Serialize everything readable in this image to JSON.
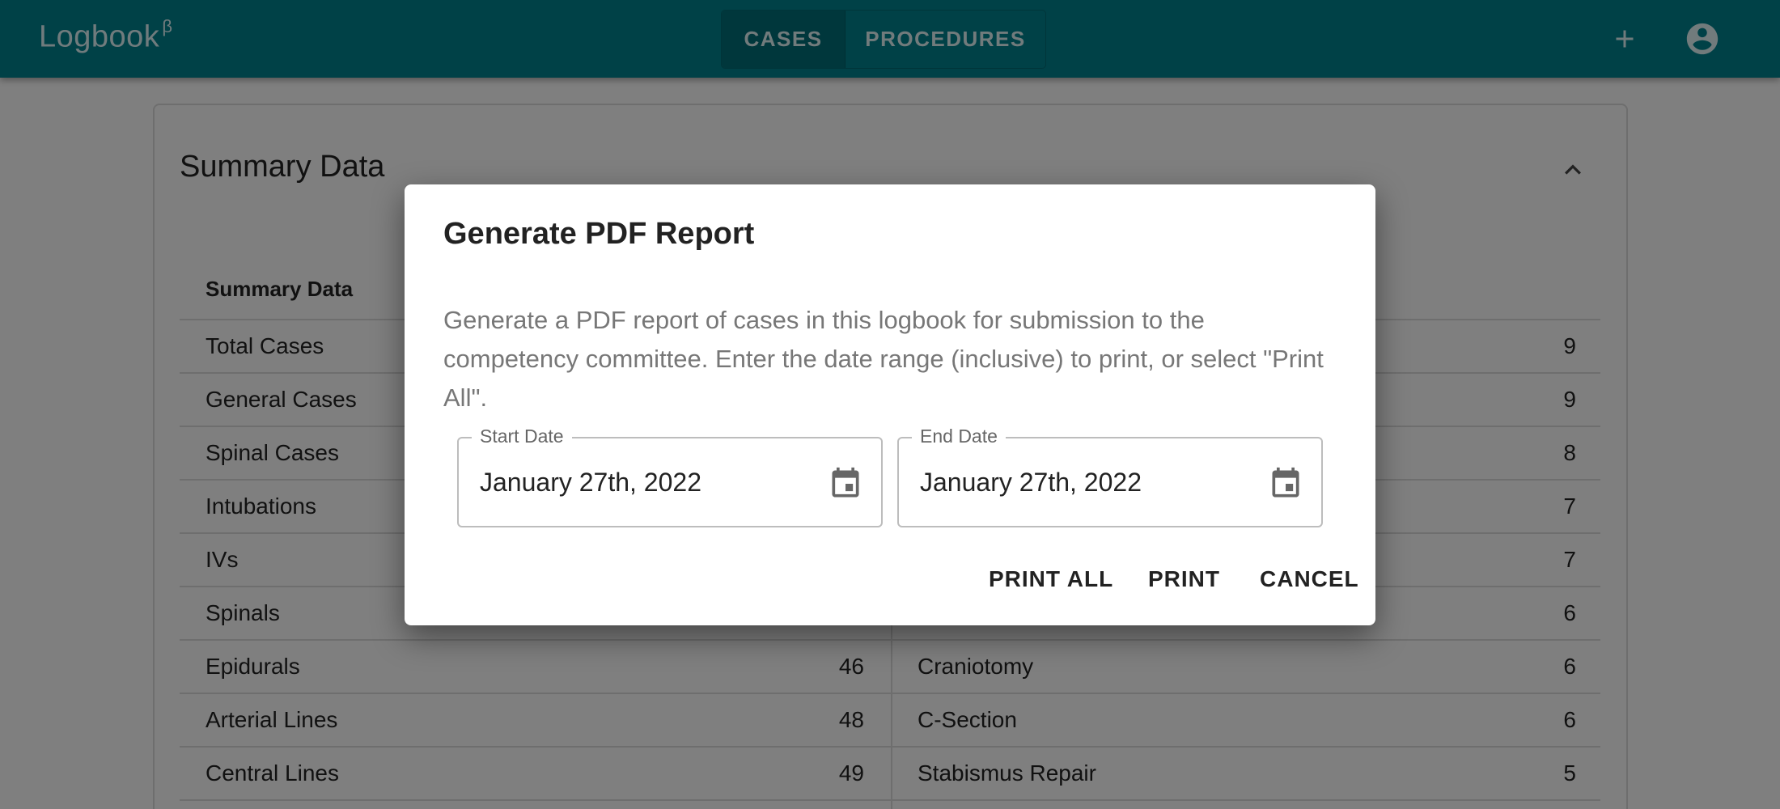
{
  "app": {
    "title": "Logbook",
    "beta": "β"
  },
  "nav": {
    "tabs": [
      {
        "label": "CASES",
        "active": true
      },
      {
        "label": "PROCEDURES",
        "active": false
      }
    ],
    "actions": [
      "add-icon",
      "account-circle-icon"
    ]
  },
  "summary": {
    "title": "Summary Data",
    "column_header": "Summary Data",
    "left_rows": [
      {
        "label": "Total Cases",
        "value": ""
      },
      {
        "label": "General Cases",
        "value": ""
      },
      {
        "label": "Spinal Cases",
        "value": ""
      },
      {
        "label": "Intubations",
        "value": ""
      },
      {
        "label": "IVs",
        "value": ""
      },
      {
        "label": "Spinals",
        "value": ""
      },
      {
        "label": "Epidurals",
        "value": "46"
      },
      {
        "label": "Arterial Lines",
        "value": "48"
      },
      {
        "label": "Central Lines",
        "value": "49"
      }
    ],
    "right_rows": [
      {
        "label": "",
        "value": "9"
      },
      {
        "label": "",
        "value": "9"
      },
      {
        "label": "",
        "value": "8"
      },
      {
        "label": "",
        "value": "7"
      },
      {
        "label": "",
        "value": "7"
      },
      {
        "label": "",
        "value": "6"
      },
      {
        "label": "Craniotomy",
        "value": "6"
      },
      {
        "label": "C-Section",
        "value": "6"
      },
      {
        "label": "Stabismus Repair",
        "value": "5"
      }
    ]
  },
  "dialog": {
    "title": "Generate PDF Report",
    "body": "Generate a PDF report of cases in this logbook for submission to the competency committee. Enter the date range (inclusive) to print, or select \"Print All\".",
    "start_date": {
      "label": "Start Date",
      "value": "January 27th, 2022"
    },
    "end_date": {
      "label": "End Date",
      "value": "January 27th, 2022"
    },
    "buttons": {
      "print_all": "PRINT ALL",
      "print": "PRINT",
      "cancel": "CANCEL"
    }
  },
  "colors": {
    "app_bar": "#00838f",
    "active_tab": "#006f79",
    "scrim": "rgba(0,0,0,0.5)"
  }
}
